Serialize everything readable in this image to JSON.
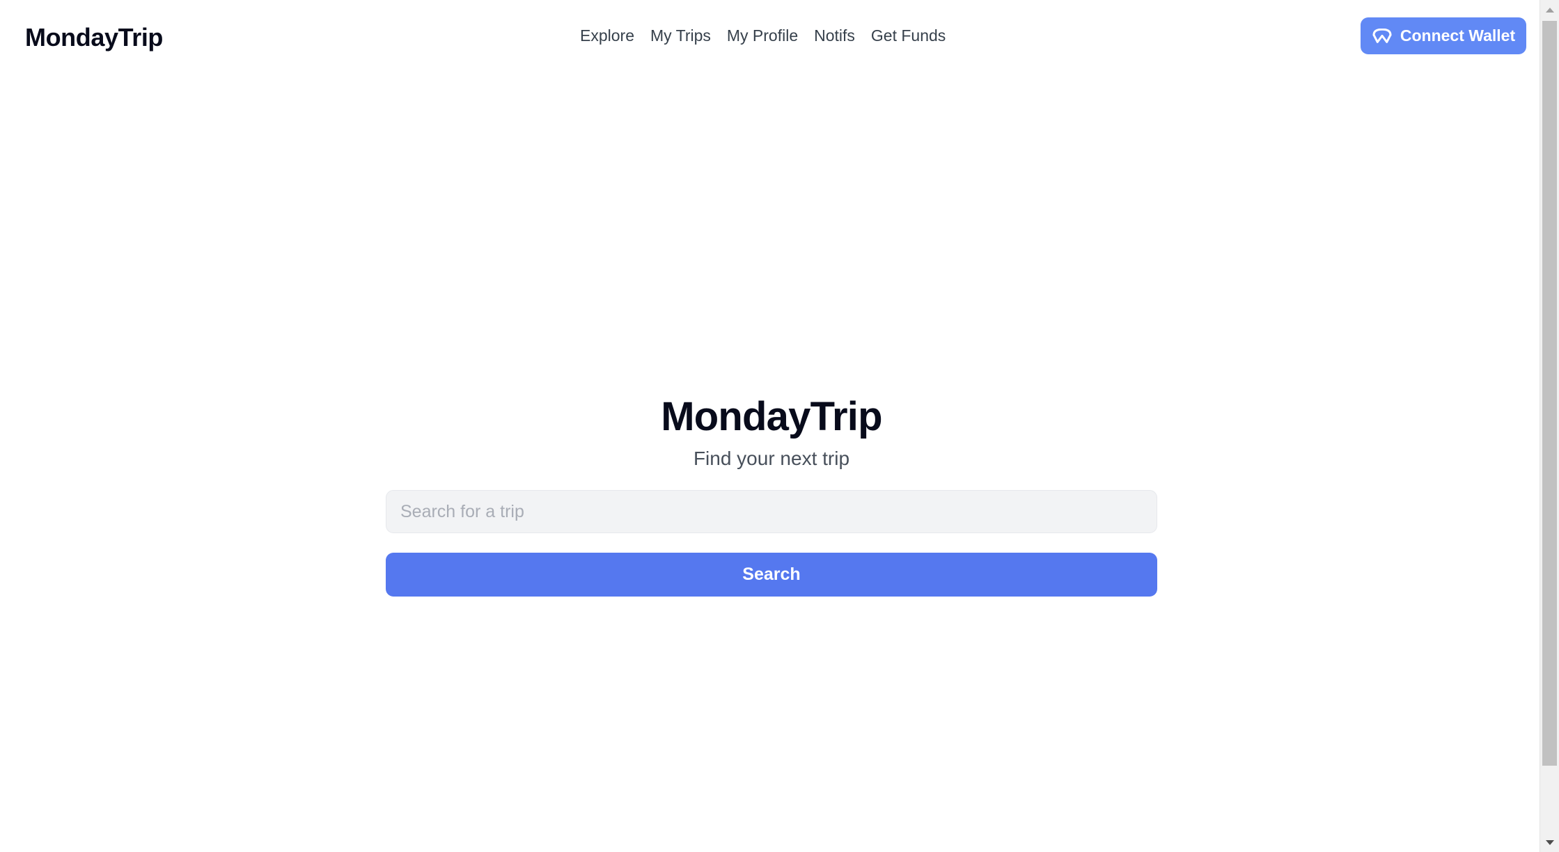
{
  "header": {
    "brand": "MondayTrip",
    "nav": [
      {
        "label": "Explore"
      },
      {
        "label": "My Trips"
      },
      {
        "label": "My Profile"
      },
      {
        "label": "Notifs"
      },
      {
        "label": "Get Funds"
      }
    ],
    "wallet_button": {
      "label": "Connect Wallet",
      "icon": "wallet-connect-icon",
      "color": "#6189f5",
      "text_color": "#ffffff"
    }
  },
  "hero": {
    "title": "MondayTrip",
    "subtitle": "Find your next trip",
    "title_color": "#080b1b",
    "subtitle_color": "#474f5a"
  },
  "search": {
    "input_value": "",
    "placeholder": "Search for a trip",
    "input_background": "#f2f3f5",
    "button_label": "Search",
    "button_color": "#5578ef",
    "button_text_color": "#ffffff"
  },
  "scrollbar": {
    "up_arrow_icon": "chevron-up-icon",
    "down_arrow_icon": "chevron-down-icon",
    "thumb_color": "#c1c1c1",
    "track_color": "#f1f1f1"
  },
  "page": {
    "background": "#ffffff"
  }
}
